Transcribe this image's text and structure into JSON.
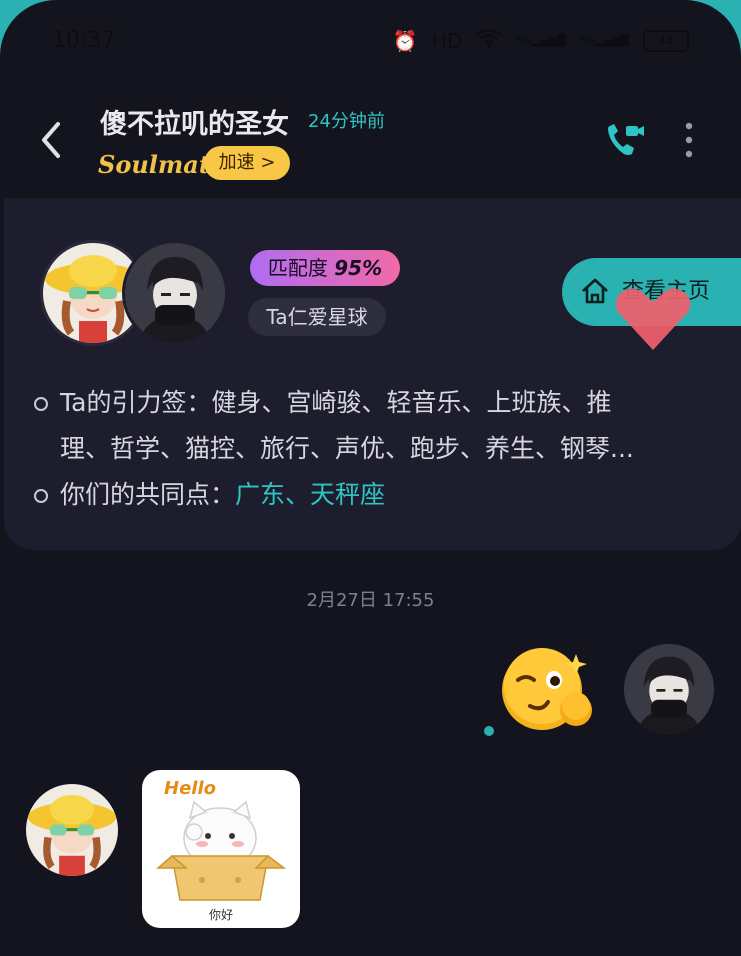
{
  "status_bar": {
    "time": "10:37",
    "hd": "HD",
    "net1": "5G",
    "net2": "5G",
    "battery": "44"
  },
  "header": {
    "contact_name": "傻不拉叽的圣女",
    "last_seen": "24分钟前",
    "brand": "Soulmate",
    "speed_label": "加速 >",
    "icons": {
      "back": "chevron-left-icon",
      "call": "video-call-icon",
      "more": "more-vertical-icon"
    }
  },
  "match_card": {
    "match_label": "匹配度",
    "match_value": "95%",
    "planet_label": "Ta仁爱星球",
    "homepage_label": "查看主页",
    "tags_line": "Ta的引力签：健身、宫崎骏、轻音乐、上班族、推理、哲学、猫控、旅行、声优、跑步、养生、钢琴...",
    "tags_line_1": "Ta的引力签：健身、宫崎骏、轻音乐、上班族、推",
    "tags_line_2": "理、哲学、猫控、旅行、声优、跑步、养生、钢琴...",
    "common_label": "你们的共同点：",
    "common_value": "广东、天秤座"
  },
  "chat": {
    "date": "2月27日 17:55",
    "messages": [
      {
        "from": "me",
        "type": "emoji",
        "content": "wink-emoji"
      },
      {
        "from": "her",
        "type": "sticker",
        "hello": "Hello",
        "caption": "你好"
      }
    ]
  },
  "colors": {
    "accent": "#2ab1b1",
    "background": "#14141f",
    "card": "#1e1d2e",
    "speed": "#f7c745"
  }
}
